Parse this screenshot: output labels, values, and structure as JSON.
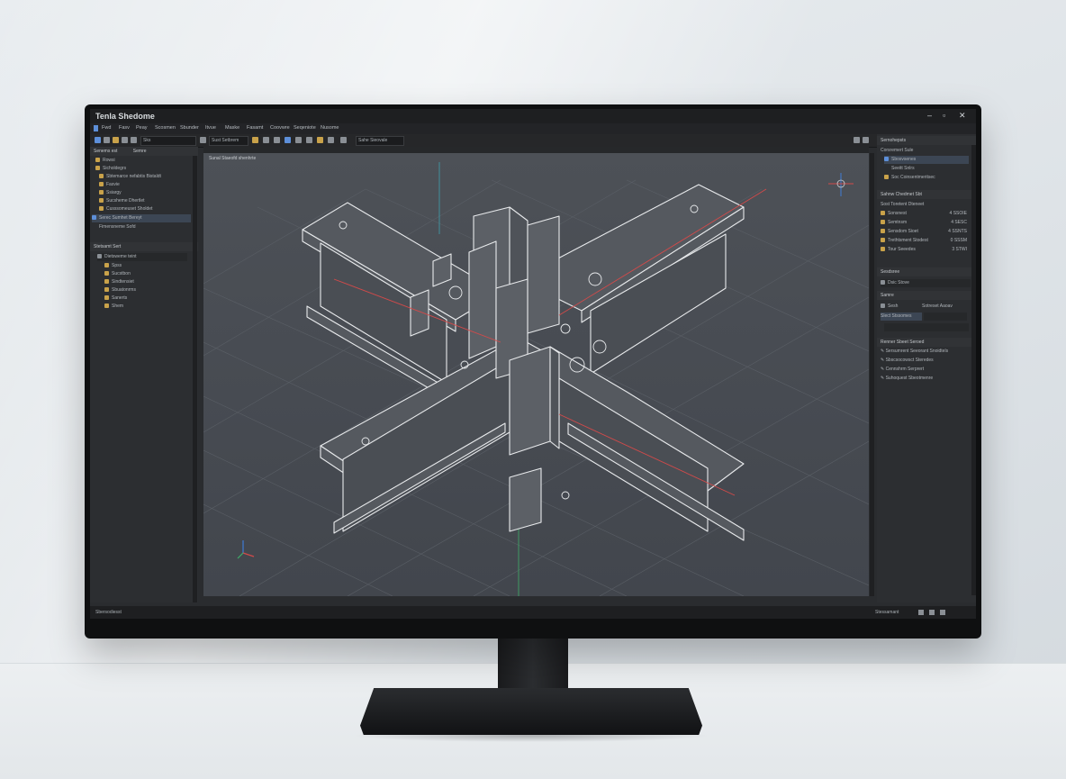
{
  "app": {
    "title": "Tenla Shedome"
  },
  "menu": [
    "Fwd",
    "Fasv",
    "Peay",
    "Scosmen",
    "Sbunder",
    "Itvue",
    "Maske",
    "Fasamt",
    "Coovwre",
    "Seqeniote",
    "Nusome"
  ],
  "toolbar": {
    "field1": "Sks",
    "field2": "Sust Setbrem",
    "field3": "Sahe Sieovale"
  },
  "left_panel": {
    "tabs": [
      "Senems est",
      "Semre"
    ],
    "tree": [
      {
        "label": "Rowsi",
        "color": "#c9a24a"
      },
      {
        "label": "Sicholdegrs",
        "color": "#c9a24a"
      },
      {
        "label": "Sbtemarce nefabtis Bistaldt",
        "color": "#c9a24a"
      },
      {
        "label": "Fasvie",
        "color": "#c9a24a"
      },
      {
        "label": "Ssiargy",
        "color": "#c9a24a"
      },
      {
        "label": "Sucsheme Dhertlet",
        "color": "#c9a24a"
      },
      {
        "label": "Cusssomeuset Sholdet",
        "color": "#c9a24a"
      }
    ],
    "selected_row": "Serec Sumhet Bereyt",
    "sub_row": "Fimensneme Sofd",
    "section2": "Stetsamt Sert",
    "list": [
      "Dietsweme teint",
      "Spss",
      "Sucstbon",
      "Sindtensiet",
      "Sbuatonrms",
      "Sanerts",
      "Shem"
    ]
  },
  "viewport": {
    "label": "Sunal Staeofd shenhrte"
  },
  "right_panel": {
    "head": "Sernohepsts",
    "rows": [
      "Corsremert Sule",
      "Sbosvsenes",
      "Seeitt Snlrs",
      "Soc Coinsentmeritsec"
    ],
    "section_props": "Sahnw  Chedmet Sbt",
    "props_title": "Sost Toretent Dteneet",
    "props": [
      {
        "label": "Sonsnest",
        "value": "4  SSOIE"
      },
      {
        "label": "Semtnsm",
        "value": "4  SESC"
      },
      {
        "label": "Sensdom Sioet",
        "value": "4  SSNTS"
      },
      {
        "label": "Trethtsment Stodest",
        "value": "0  SSSM"
      },
      {
        "label": "Tour Seeedes",
        "value": "3  STWI"
      }
    ],
    "section_sel": "Sesdsree",
    "sel_row": "Dsic  Stove",
    "section_tr": "Samre",
    "tr_row1": "Sesh",
    "tr_row2": "Sotreset Aaoav",
    "tr_row3": "Slect Stssomes",
    "section_act": "Renner  Sbeet Seroed",
    "actions": [
      "Sersumrent Seeorant Snoidtels",
      "Sbscsocowsct Steredes",
      "Cennshrm Serprert",
      "Suhoquest Sbeotmenre"
    ]
  },
  "status": {
    "left": "Sbersodiesst",
    "right": "Stessamant"
  },
  "colors": {
    "accent": "#5d8fd9",
    "selection": "#3c4654",
    "axis_red": "#d24a4a",
    "axis_green": "#3fae6a",
    "axis_blue": "#3f7bd6"
  }
}
